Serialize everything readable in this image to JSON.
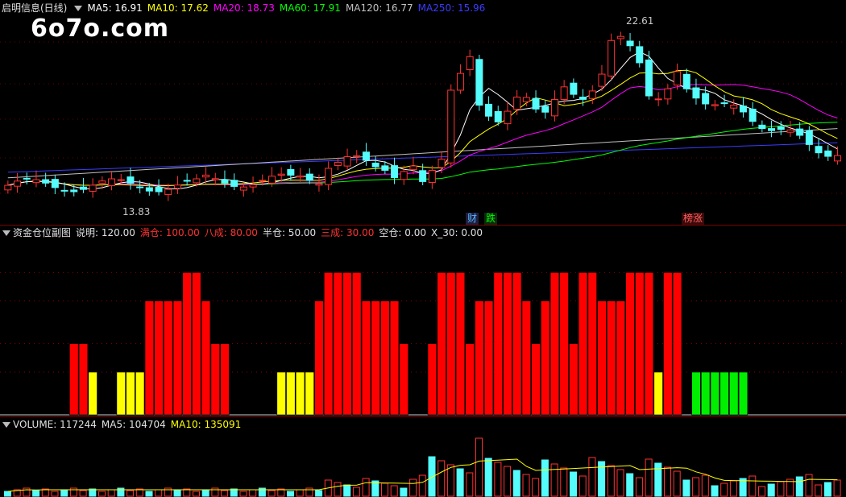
{
  "price_legend": {
    "title": "启明信息(日线)",
    "ma5": "MA5: 16.91",
    "ma10": "MA10: 17.62",
    "ma20": "MA20: 18.73",
    "ma60": "MA60: 17.91",
    "ma120": "MA120: 16.77",
    "ma250": "MA250: 15.96"
  },
  "watermark": "6o7o.com",
  "annotations": {
    "high": "22.61",
    "low": "13.83",
    "tag_cai": "财",
    "tag_die": "跌",
    "tag_bangzhang": "榜涨"
  },
  "indicator_legend": {
    "title": "资金仓位副图",
    "shuoming": "说明: 120.00",
    "mancang": "满仓: 100.00",
    "bacheng": "八成: 80.00",
    "bancang": "半仓: 50.00",
    "sancheng": "三成: 30.00",
    "kongcang": "空仓: 0.00",
    "x30": "X_30: 0.00"
  },
  "volume_legend": {
    "title": "VOLUME: 117244",
    "ma5": "MA5: 104704",
    "ma10": "MA10: 135091"
  },
  "colors": {
    "up": "#ff3232",
    "down": "#54fcfc",
    "ma5": "#ffffff",
    "ma10": "#ffff00",
    "ma20": "#ff00ff",
    "ma60": "#00ff00",
    "ma120": "#c0c0c0",
    "ma250": "#3b3bff",
    "pos_full": "#ff0000",
    "pos_half": "#ffff00",
    "pos_empty": "#00ee00"
  },
  "chart_data": {
    "type": "bar",
    "title": "资金仓位副图",
    "levels": {
      "full": 100,
      "eighty": 80,
      "half": 50,
      "thirty": 30,
      "empty": 0
    },
    "values": [
      0,
      0,
      0,
      0,
      0,
      0,
      0,
      50,
      50,
      30,
      0,
      0,
      30,
      30,
      30,
      80,
      80,
      80,
      80,
      100,
      100,
      80,
      50,
      50,
      0,
      0,
      0,
      0,
      0,
      30,
      30,
      30,
      30,
      80,
      100,
      100,
      100,
      100,
      80,
      80,
      80,
      80,
      50,
      0,
      0,
      50,
      100,
      100,
      100,
      50,
      80,
      80,
      100,
      100,
      100,
      80,
      50,
      80,
      100,
      100,
      50,
      100,
      100,
      80,
      80,
      80,
      100,
      100,
      100,
      30,
      100,
      100,
      0,
      30,
      30,
      30,
      30,
      30,
      30,
      0,
      0,
      0,
      0,
      0,
      0,
      0,
      0,
      0,
      0
    ]
  }
}
